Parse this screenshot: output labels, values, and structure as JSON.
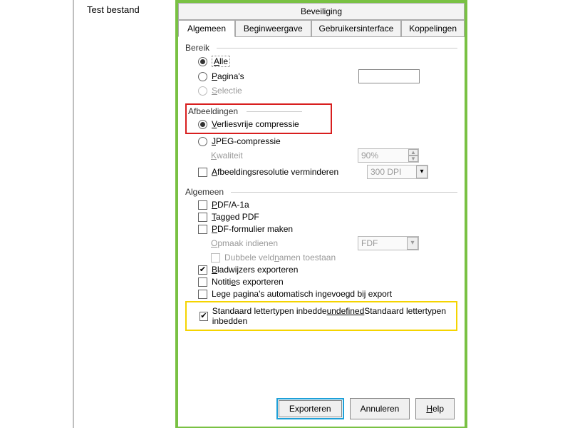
{
  "page": {
    "body_text": "Test bestand"
  },
  "tabs": {
    "security": "Beveiliging",
    "general": "Algemeen",
    "initial_view": "Beginweergave",
    "ui": "Gebruikersinterface",
    "links": "Koppelingen"
  },
  "sections": {
    "range": {
      "title": "Bereik",
      "all": "Alle",
      "pages": "Pagina's",
      "selection": "Selectie"
    },
    "images": {
      "title": "Afbeeldingen",
      "lossless": "Verliesvrije compressie",
      "jpeg": "JPEG-compressie",
      "quality_label": "Kwaliteit",
      "quality_value": "90%",
      "reduce_label": "Afbeeldingsresolutie verminderen",
      "dpi_value": "300 DPI"
    },
    "general": {
      "title": "Algemeen",
      "pdfa": "PDF/A-1a",
      "tagged": "Tagged PDF",
      "form": "PDF-formulier maken",
      "submit_label": "Opmaak indienen",
      "submit_value": "FDF",
      "dup_fields": "Dubbele veldnamen toestaan",
      "bookmarks": "Bladwijzers exporteren",
      "notes": "Notities exporteren",
      "blank_pages": "Lege pagina's automatisch ingevoegd bij export",
      "embed_fonts": "Standaard lettertypen inbedden"
    }
  },
  "buttons": {
    "export": "Exporteren",
    "cancel": "Annuleren",
    "help": "Help"
  }
}
